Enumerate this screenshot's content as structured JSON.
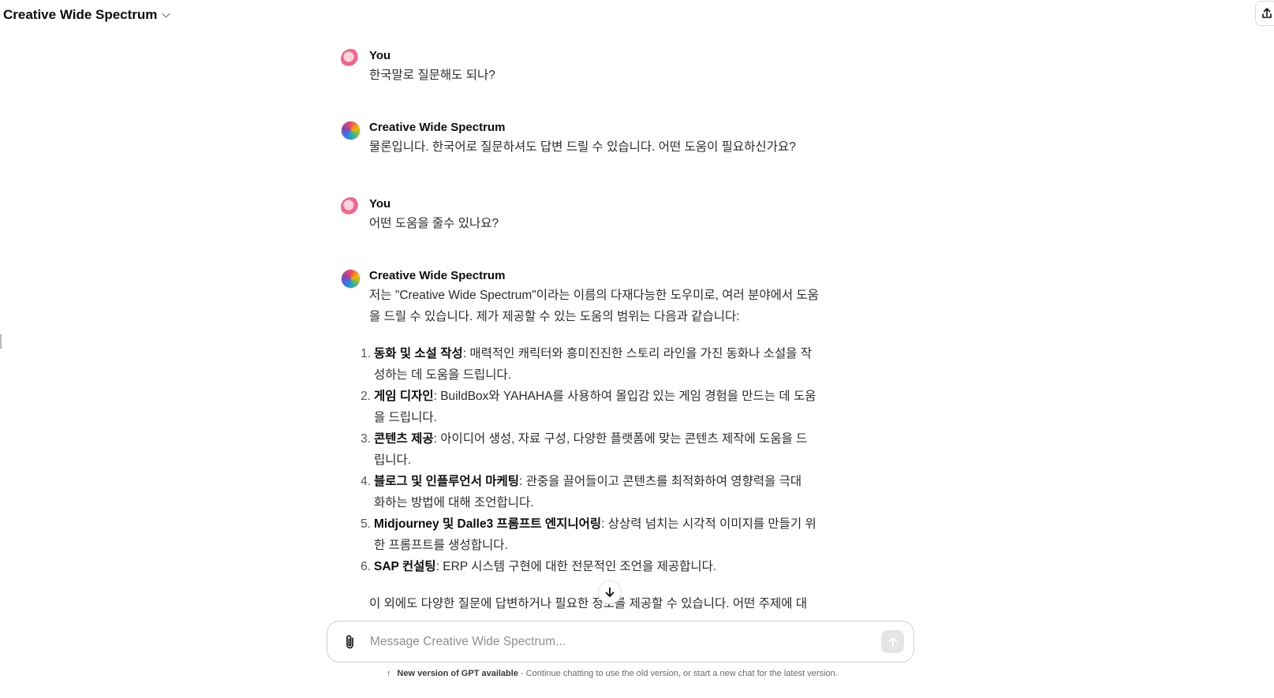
{
  "header": {
    "model_name": "Creative Wide Spectrum"
  },
  "conversation": [
    {
      "author": "You",
      "text": "한국말로 질문해도 되나?"
    },
    {
      "author": "Creative Wide Spectrum",
      "text": "물론입니다. 한국어로 질문하셔도 답변 드릴 수 있습니다. 어떤 도움이 필요하신가요?"
    },
    {
      "author": "You",
      "text": "어떤 도움을 줄수 있나요?"
    },
    {
      "author": "Creative Wide Spectrum",
      "intro_line1": "저는 \"Creative Wide Spectrum\"이라는 이름의 다재다능한 도우미로, 여러 분야에서 도움",
      "intro_line2": "을 드릴 수 있습니다. 제가 제공할 수 있는 도움의 범위는 다음과 같습니다:",
      "items": [
        {
          "num": "1.",
          "title": "동화 및 소설 작성",
          "line1": ": 매력적인 캐릭터와 흥미진진한 스토리 라인을 가진 동화나 소설을 작",
          "line2": "성하는 데 도움을 드립니다."
        },
        {
          "num": "2.",
          "title": "게임 디자인",
          "line1": ": BuildBox와 YAHAHA를 사용하여 몰입감 있는 게임 경험을 만드는 데 도움",
          "line2": "을 드립니다."
        },
        {
          "num": "3.",
          "title": "콘텐츠 제공",
          "line1": ": 아이디어 생성, 자료 구성, 다양한 플랫폼에 맞는 콘텐츠 제작에 도움을 드",
          "line2": "립니다."
        },
        {
          "num": "4.",
          "title": "블로그 및 인플루언서 마케팅",
          "line1": ": 관중을 끌어들이고 콘텐츠를 최적화하여 영향력을 극대",
          "line2": "화하는 방법에 대해 조언합니다."
        },
        {
          "num": "5.",
          "title": "Midjourney 및 Dalle3 프롬프트 엔지니어링",
          "line1": ": 상상력 넘치는 시각적 이미지를 만들기 위",
          "line2": "한 프롬프트를 생성합니다."
        },
        {
          "num": "6.",
          "title": "SAP 컨설팅",
          "line1": ": ERP 시스템 구현에 대한 전문적인 조언을 제공합니다.",
          "line2": ""
        }
      ],
      "outro": "이 외에도 다양한 질문에 답변하거나 필요한 정보를 제공할 수 있습니다. 어떤 주제에 대"
    }
  ],
  "composer": {
    "placeholder": "Message Creative Wide Spectrum..."
  },
  "footer": {
    "bold": "New version of GPT available",
    "rest": " - Continue chatting to use the old version, or start a new chat for the latest version."
  }
}
